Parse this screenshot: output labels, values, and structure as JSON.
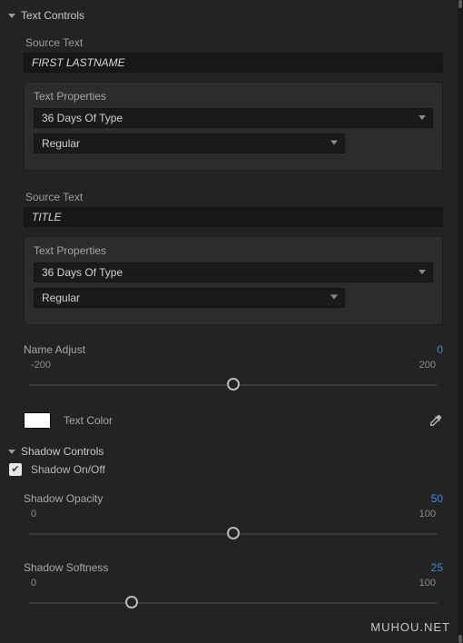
{
  "textControls": {
    "title": "Text Controls",
    "block1": {
      "sourceLabel": "Source Text",
      "sourceValue": "FIRST LASTNAME",
      "propsLabel": "Text Properties",
      "font": "36 Days Of Type",
      "weight": "Regular"
    },
    "block2": {
      "sourceLabel": "Source Text",
      "sourceValue": "TITLE",
      "propsLabel": "Text Properties",
      "font": "36 Days Of Type",
      "weight": "Regular"
    },
    "nameAdjust": {
      "label": "Name Adjust",
      "value": "0",
      "min": "-200",
      "max": "200",
      "pos": 50
    },
    "textColor": {
      "label": "Text Color",
      "hex": "#ffffff"
    }
  },
  "shadowControls": {
    "title": "Shadow Controls",
    "toggleLabel": "Shadow On/Off",
    "toggleChecked": true,
    "opacity": {
      "label": "Shadow Opacity",
      "value": "50",
      "min": "0",
      "max": "100",
      "pos": 50
    },
    "softness": {
      "label": "Shadow Softness",
      "value": "25",
      "min": "0",
      "max": "100",
      "pos": 25
    }
  },
  "watermark": "MUHOU.NET"
}
